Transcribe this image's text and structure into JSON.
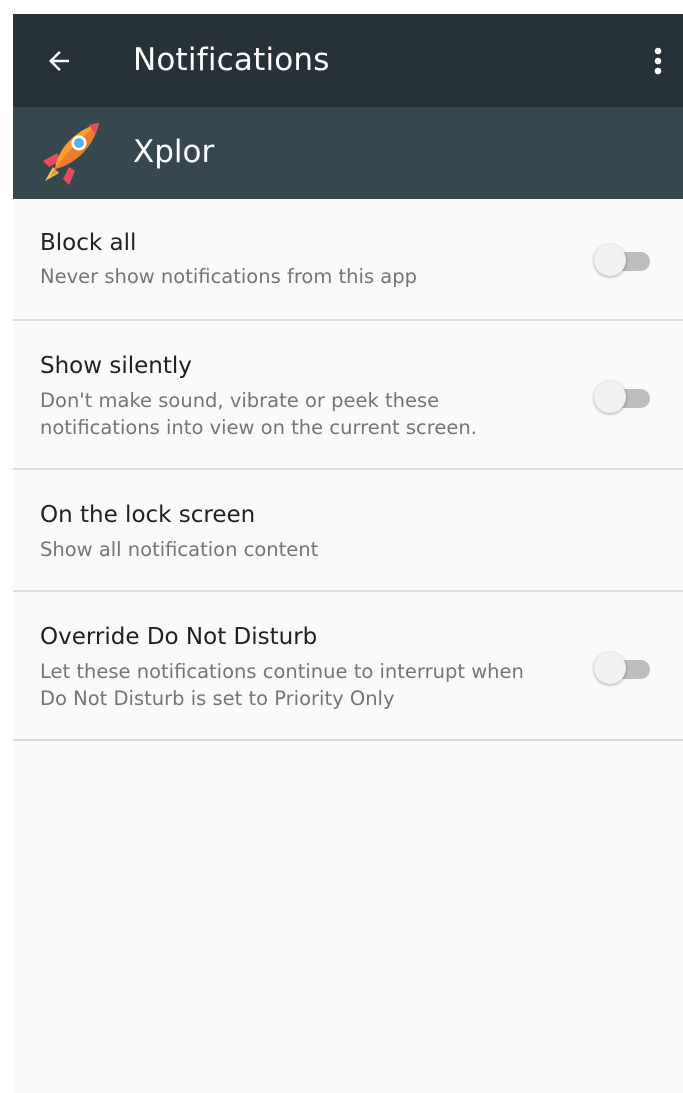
{
  "toolbar": {
    "title": "Notifications",
    "back_icon": "arrow-back-icon",
    "overflow_icon": "more-vert-icon"
  },
  "app": {
    "name": "Xplor",
    "icon": "rocket-icon"
  },
  "settings": [
    {
      "title": "Block all",
      "subtitle": "Never show notifications from this app",
      "has_toggle": true,
      "toggle_on": false
    },
    {
      "title": "Show silently",
      "subtitle": "Don't make sound, vibrate or peek these\nnotifications into view on the current screen.",
      "has_toggle": true,
      "toggle_on": false
    },
    {
      "title": "On the lock screen",
      "subtitle": "Show all notification content",
      "has_toggle": false
    },
    {
      "title": "Override Do Not Disturb",
      "subtitle": "Let these notifications continue to interrupt when\nDo Not Disturb is set to Priority Only",
      "has_toggle": true,
      "toggle_on": false
    }
  ],
  "colors": {
    "toolbar": "#263238",
    "app_header": "#37474f",
    "background": "#fafafa",
    "divider": "#dcdcdc",
    "title_text": "#212121",
    "subtitle_text": "#757575"
  }
}
